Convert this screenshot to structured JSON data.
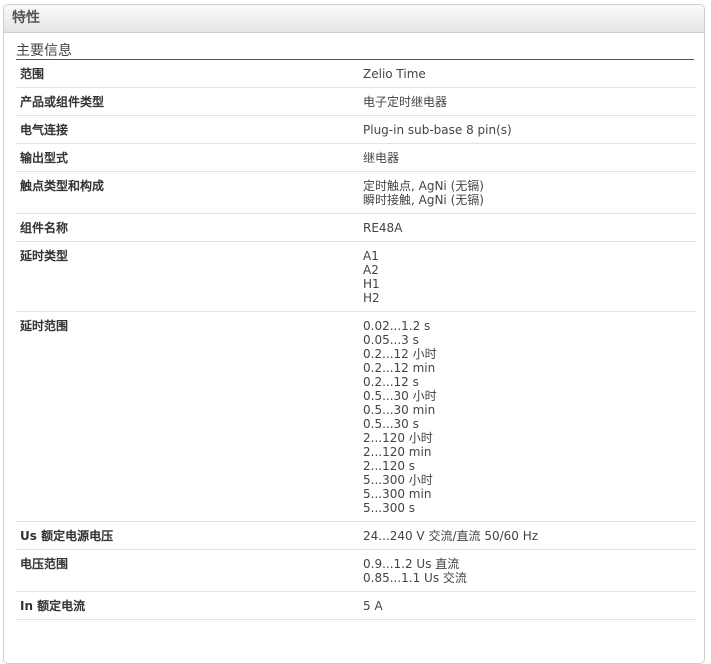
{
  "panel": {
    "title": "特性"
  },
  "section": {
    "title": "主要信息"
  },
  "rows": [
    {
      "label": "范围",
      "values": [
        "Zelio Time"
      ]
    },
    {
      "label": "产品或组件类型",
      "values": [
        "电子定时继电器"
      ]
    },
    {
      "label": "电气连接",
      "values": [
        "Plug-in sub-base 8 pin(s)"
      ]
    },
    {
      "label": "输出型式",
      "values": [
        "继电器"
      ]
    },
    {
      "label": "触点类型和构成",
      "values": [
        "定时触点, AgNi (无镉)",
        "瞬时接触, AgNi (无镉)"
      ]
    },
    {
      "label": "组件名称",
      "values": [
        "RE48A"
      ]
    },
    {
      "label": "延时类型",
      "values": [
        "A1",
        "A2",
        "H1",
        "H2"
      ]
    },
    {
      "label": "延时范围",
      "values": [
        "0.02...1.2 s",
        "0.05...3 s",
        "0.2...12 小时",
        "0.2...12 min",
        "0.2...12 s",
        "0.5...30 小时",
        "0.5...30 min",
        "0.5...30 s",
        "2...120 小时",
        "2...120 min",
        "2...120 s",
        "5...300 小时",
        "5...300 min",
        "5...300 s"
      ]
    },
    {
      "label": "Us 额定电源电压",
      "values": [
        "24...240 V 交流/直流 50/60 Hz"
      ]
    },
    {
      "label": "电压范围",
      "values": [
        "0.9...1.2 Us 直流",
        "0.85...1.1 Us 交流"
      ]
    },
    {
      "label": "In 额定电流",
      "values": [
        "5 A"
      ]
    }
  ]
}
